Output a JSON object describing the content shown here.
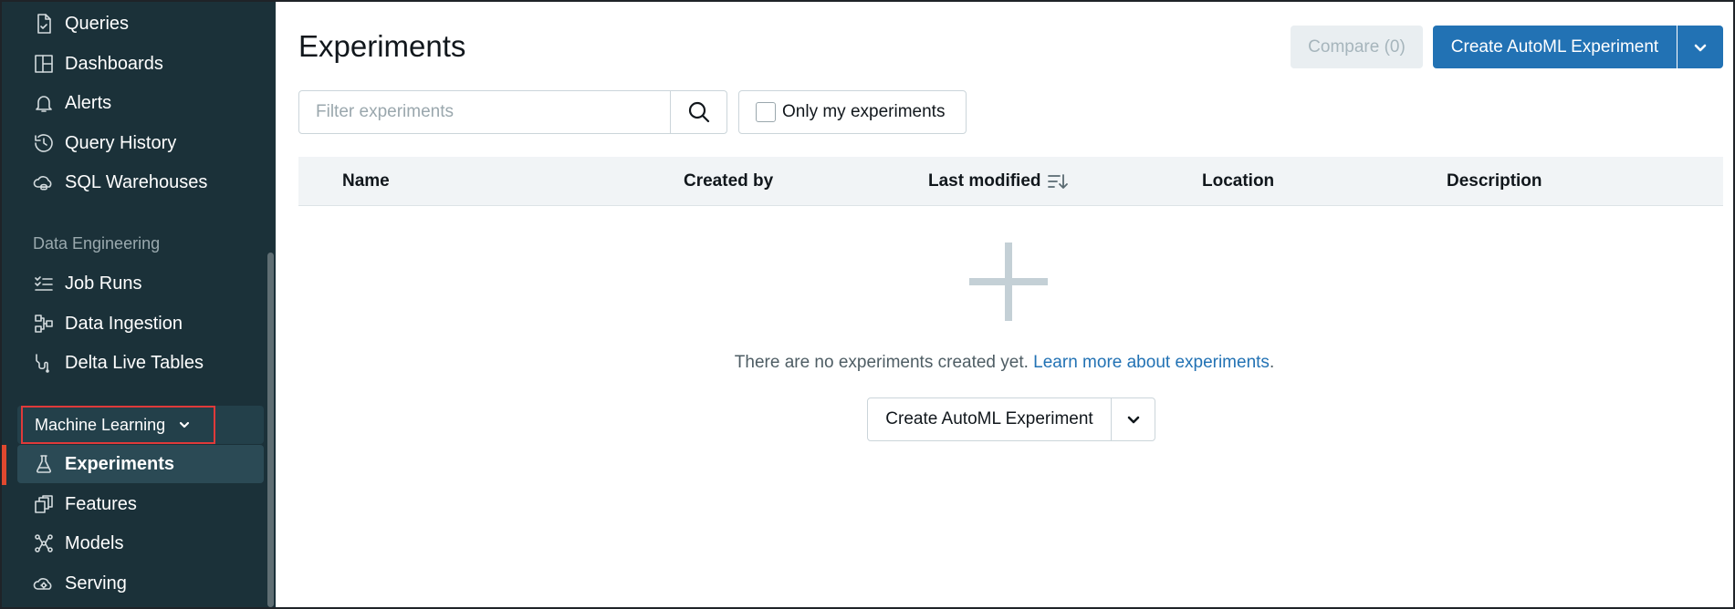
{
  "sidebar": {
    "items_top": [
      {
        "label": "Queries",
        "icon": "queries-icon"
      },
      {
        "label": "Dashboards",
        "icon": "dashboards-icon"
      },
      {
        "label": "Alerts",
        "icon": "bell-icon"
      },
      {
        "label": "Query History",
        "icon": "history-icon"
      },
      {
        "label": "SQL Warehouses",
        "icon": "warehouse-icon"
      }
    ],
    "section_data_engineering": "Data Engineering",
    "items_de": [
      {
        "label": "Job Runs",
        "icon": "job-runs-icon"
      },
      {
        "label": "Data Ingestion",
        "icon": "data-ingestion-icon"
      },
      {
        "label": "Delta Live Tables",
        "icon": "pipeline-icon"
      }
    ],
    "section_ml": "Machine Learning",
    "items_ml": [
      {
        "label": "Experiments",
        "icon": "flask-icon",
        "active": true
      },
      {
        "label": "Features",
        "icon": "features-icon"
      },
      {
        "label": "Models",
        "icon": "models-icon"
      },
      {
        "label": "Serving",
        "icon": "serving-icon"
      }
    ]
  },
  "main": {
    "title": "Experiments",
    "compare_label": "Compare (0)",
    "create_automl_label": "Create AutoML Experiment",
    "filter_placeholder": "Filter experiments",
    "only_mine_label": "Only my experiments",
    "columns": [
      "Name",
      "Created by",
      "Last modified",
      "Location",
      "Description"
    ],
    "empty_text": "There are no experiments created yet.",
    "learn_more_link": "Learn more about experiments",
    "empty_create_label": "Create AutoML Experiment"
  },
  "colors": {
    "sidebar_bg": "#1b3139",
    "accent_blue": "#2272b4",
    "active_marker": "#e0482f",
    "highlight_box": "#e03a3a"
  }
}
